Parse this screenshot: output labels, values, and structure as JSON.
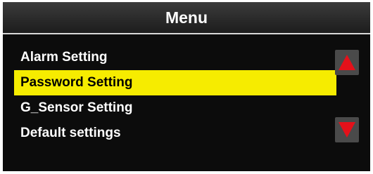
{
  "header": {
    "title": "Menu"
  },
  "menu": {
    "selected_index": 1,
    "items": [
      {
        "label": "Alarm Setting"
      },
      {
        "label": "Password Setting"
      },
      {
        "label": "G_Sensor Setting"
      },
      {
        "label": "Default settings"
      }
    ]
  },
  "scroll": {
    "up_icon": "triangle-up-icon",
    "down_icon": "triangle-down-icon"
  },
  "colors": {
    "background": "#0c0c0c",
    "selection": "#f6ec00",
    "arrow": "#e4111a",
    "text": "#ffffff"
  }
}
